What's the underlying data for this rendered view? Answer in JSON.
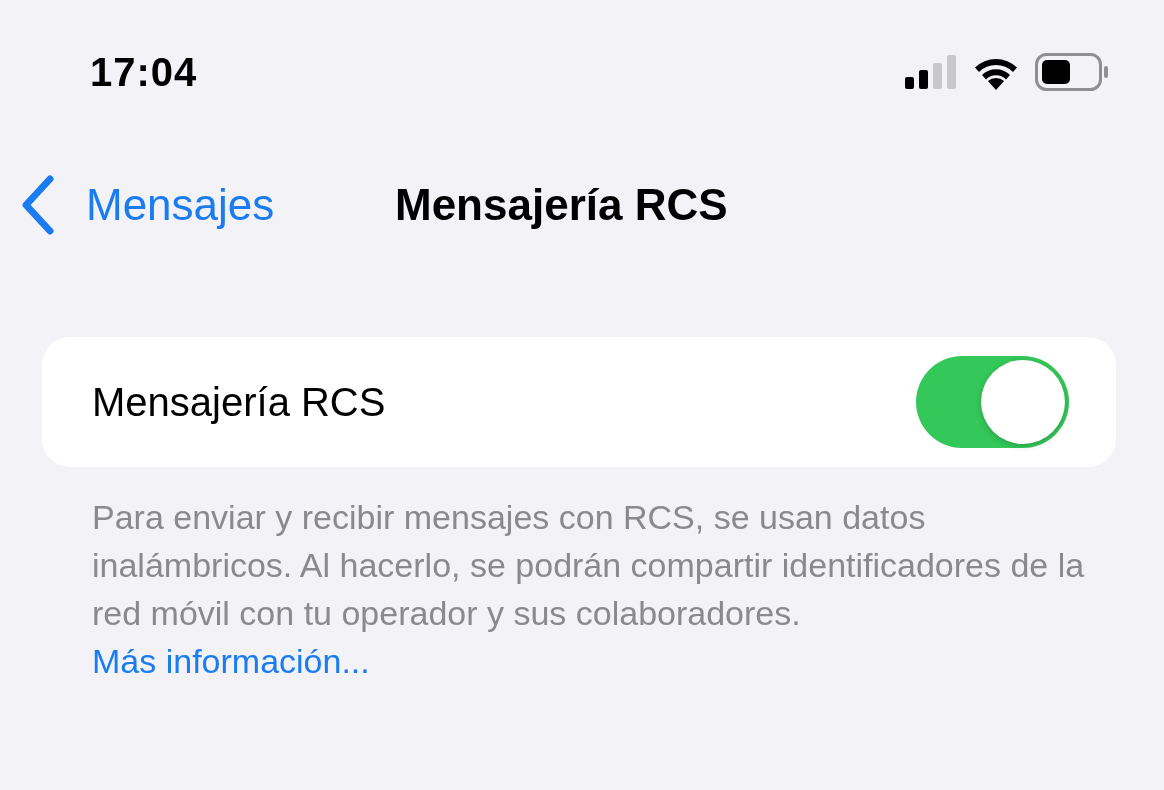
{
  "status_bar": {
    "time": "17:04"
  },
  "nav": {
    "back_label": "Mensajes",
    "title": "Mensajería RCS"
  },
  "rows": [
    {
      "label": "Mensajería RCS",
      "on": true
    }
  ],
  "footer": {
    "text": "Para enviar y recibir mensajes con RCS, se usan datos inalámbricos. Al hacerlo, se podrán compartir identificadores de la red móvil con tu operador y sus colaboradores.",
    "link": "Más información..."
  }
}
